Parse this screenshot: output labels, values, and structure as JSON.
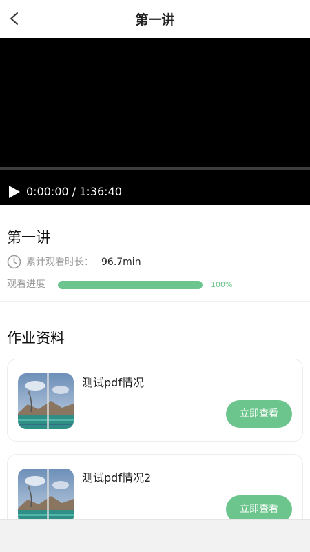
{
  "header": {
    "title": "第一讲",
    "back_icon": "chevron-left-icon"
  },
  "video": {
    "time": "0:00:00 / 1:36:40",
    "play_icon": "play-icon"
  },
  "lesson": {
    "title": "第一讲",
    "watch_label": "累计观看时长：",
    "watch_value": "96.7min",
    "progress_label": "观看进度",
    "progress_text": "100%",
    "progress_fraction": 1.0
  },
  "materials": {
    "title": "作业资料",
    "items": [
      {
        "title": "测试pdf情况",
        "button": "立即查看"
      },
      {
        "title": "测试pdf情况2",
        "button": "立即查看"
      }
    ]
  },
  "colors": {
    "accent": "#6cc58c",
    "video_bg": "#000000"
  }
}
